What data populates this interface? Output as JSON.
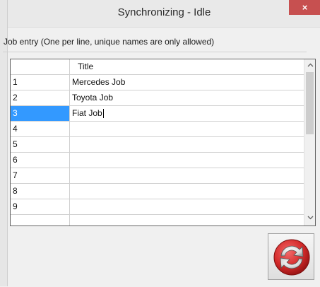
{
  "window": {
    "title": "Synchronizing - Idle",
    "close_label": "×"
  },
  "instruction": "Job entry (One per line, unique names are only allowed)",
  "grid": {
    "header": {
      "num": "",
      "title": "Title"
    },
    "rows": [
      {
        "num": "1",
        "title": "Mercedes Job"
      },
      {
        "num": "2",
        "title": "Toyota Job"
      },
      {
        "num": "3",
        "title": "Fiat Job"
      },
      {
        "num": "4",
        "title": ""
      },
      {
        "num": "5",
        "title": ""
      },
      {
        "num": "6",
        "title": ""
      },
      {
        "num": "7",
        "title": ""
      },
      {
        "num": "8",
        "title": ""
      },
      {
        "num": "9",
        "title": ""
      },
      {
        "num": "",
        "title": ""
      }
    ],
    "selected_row": "3",
    "scroll_up": "^",
    "scroll_down": "v"
  },
  "sync_button": {
    "icon": "sync-icon"
  },
  "colors": {
    "close": "#c75050",
    "selection": "#3399ff",
    "sync_red": "#d42a2a"
  }
}
